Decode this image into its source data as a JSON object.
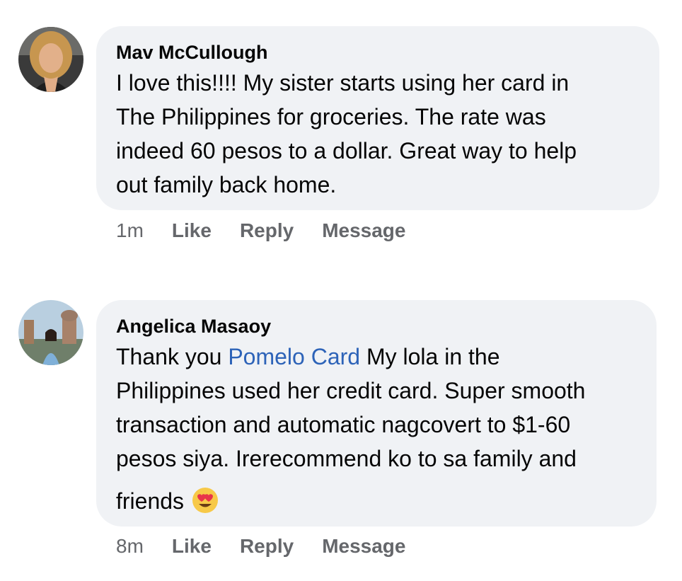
{
  "comments": [
    {
      "author": "Mav McCullough",
      "text_lines": [
        "I love this!!!! My sister starts using her card in",
        "The Philippines for groceries. The rate was",
        "indeed 60 pesos to a dollar. Great way to help",
        "out family back home."
      ],
      "time": "1m",
      "actions": {
        "like": "Like",
        "reply": "Reply",
        "message": "Message"
      }
    },
    {
      "author": "Angelica Masaoy",
      "text_prefix": "Thank you ",
      "mention": "Pomelo Card",
      "text_line1_rest": " My lola in the",
      "text_lines": [
        "Philippines used her credit card. Super smooth",
        "transaction and automatic nagcovert to $1-60",
        "pesos siya. Irerecommend ko to sa family and"
      ],
      "last_line": "friends",
      "emoji": "heart-eyes-emoji",
      "time": "8m",
      "actions": {
        "like": "Like",
        "reply": "Reply",
        "message": "Message"
      }
    }
  ],
  "colors": {
    "bubble": "#f0f2f5",
    "mention_link": "#2d63b8",
    "action_text": "#65676b"
  }
}
